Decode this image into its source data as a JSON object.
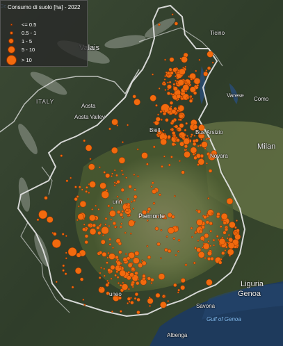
{
  "legend": {
    "title": "Consumo di suolo [ha] - 2022",
    "classes": [
      {
        "label": "<= 0.5"
      },
      {
        "label": "0.5 - 1"
      },
      {
        "label": "1 - 5"
      },
      {
        "label": "5 - 10"
      },
      {
        "label": "> 10"
      }
    ]
  },
  "labels": {
    "valais": "Valais",
    "ticino": "Ticino",
    "italy": "ITALY",
    "aosta": "Aosta",
    "aosta_valley": "Aosta Valley",
    "varese": "Varese",
    "como": "Como",
    "biella": "Biell",
    "busto_arsizio": "Bus   Arsizio",
    "milan": "Milan",
    "novara": "Novara",
    "torino": "urin",
    "piemonte": "Piemonte",
    "liguria": "Liguria",
    "genoa": "Genoa",
    "savona": "Savona",
    "gulf_of_genoa": "Gulf of Genoa",
    "albenga": "Albenga",
    "cuneo": "uneo",
    "edge_top": "Ge"
  },
  "colors": {
    "marker_fill": "#f26a0e",
    "marker_stroke": "#8a2f00",
    "sea": "#1e3a5c",
    "border": "#e8e8e8"
  }
}
